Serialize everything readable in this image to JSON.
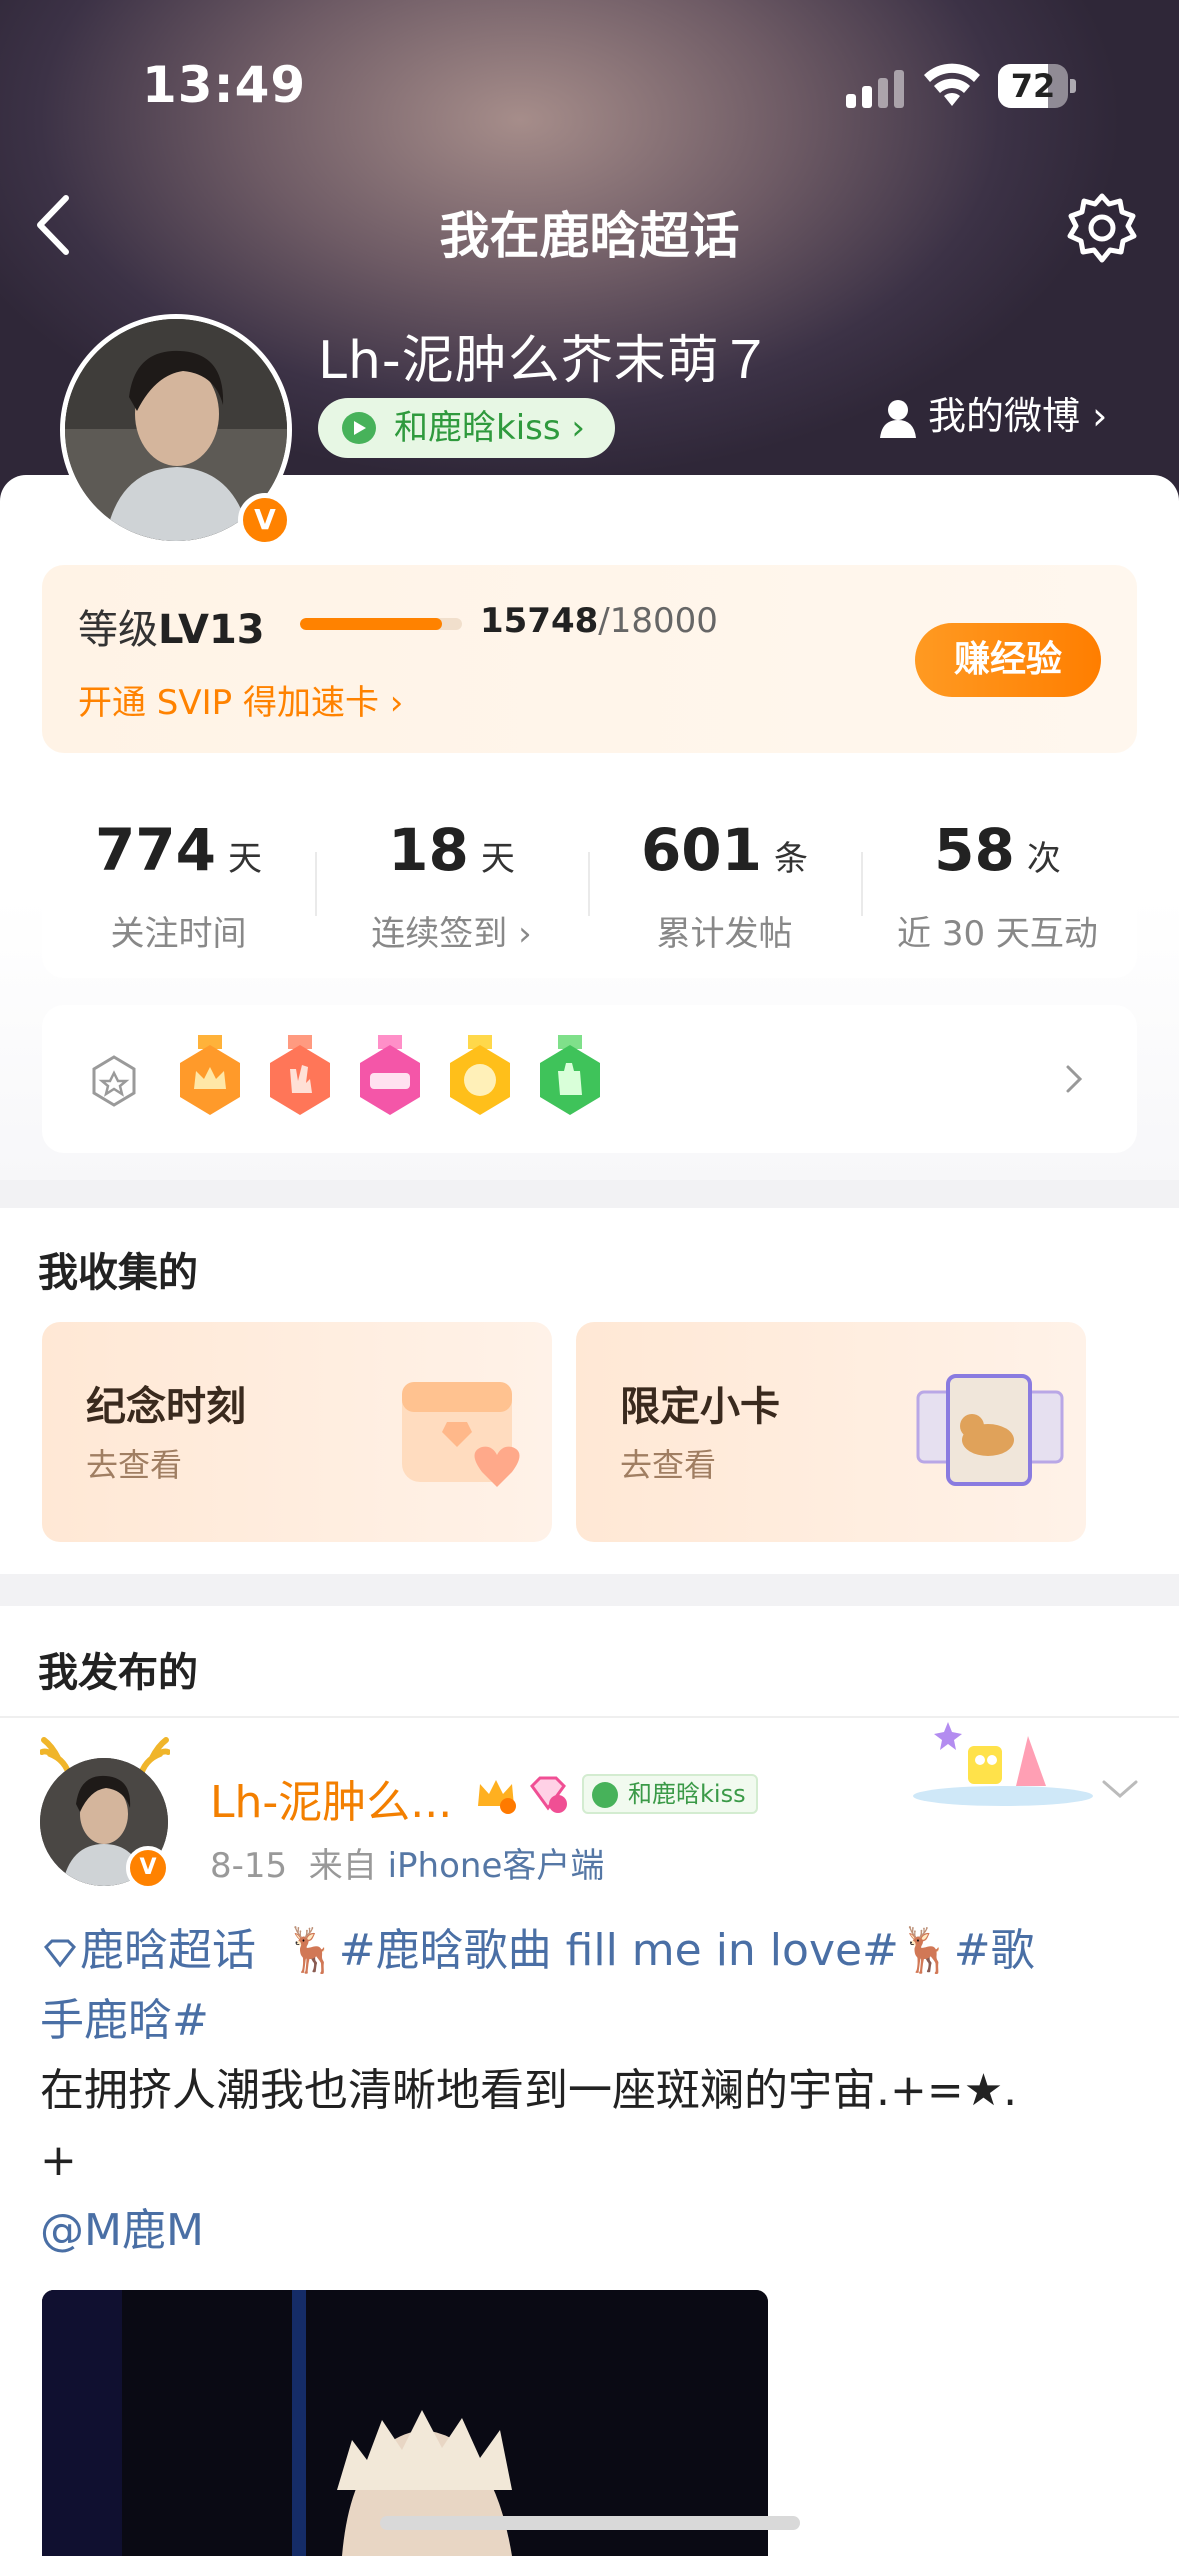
{
  "status_bar": {
    "time": "13:49",
    "battery": "72",
    "battery_level": 0.72
  },
  "nav": {
    "title": "我在鹿晗超话"
  },
  "profile": {
    "name": "Lh-泥肿么芥末萌７",
    "verified_badge": "V",
    "kiss_label": "和鹿晗kiss ›",
    "weibo_link": "我的微博 ›"
  },
  "level": {
    "label_prefix": "等级",
    "level": "LV13",
    "progress": 0.8747,
    "current_exp": "15748",
    "total_exp": "/18000",
    "svip_text": "开通 SVIP 得加速卡 ›",
    "earn_button": "赚经验"
  },
  "stats": [
    {
      "value": "774",
      "unit": "天",
      "label": "关注时间"
    },
    {
      "value": "18",
      "unit": "天",
      "label": "连续签到 ›"
    },
    {
      "value": "601",
      "unit": "条",
      "label": "累计发帖"
    },
    {
      "value": "58",
      "unit": "次",
      "label": "近 30 天互动"
    }
  ],
  "medal_icons": [
    "crown-medal-icon",
    "hand-medal-icon",
    "lv13-medal-icon",
    "hi-medal-icon",
    "wave-medal-icon"
  ],
  "collect": {
    "title": "我收集的",
    "cards": [
      {
        "title": "纪念时刻",
        "sub": "去查看"
      },
      {
        "title": "限定小卡",
        "sub": "去查看"
      }
    ]
  },
  "published": {
    "title": "我发布的",
    "post": {
      "author": "Lh-泥肿么...",
      "kiss_badge": "和鹿晗kiss",
      "date": "8-15",
      "source_prefix": "来自",
      "source": "iPhone客户端",
      "topic": "鹿晗超话",
      "hashtag1": "#鹿晗歌曲 fill me in love#",
      "hashtag2a": "#歌",
      "hashtag2b": "手鹿晗#",
      "body": " 在拥挤人潮我也清晰地看到一座斑斓的宇宙.+=★.",
      "body_end": "+",
      "mention": "@M鹿M"
    }
  },
  "colors": {
    "accent": "#ff8200",
    "link": "#4a6fa5",
    "kiss_green": "#47b25a"
  }
}
